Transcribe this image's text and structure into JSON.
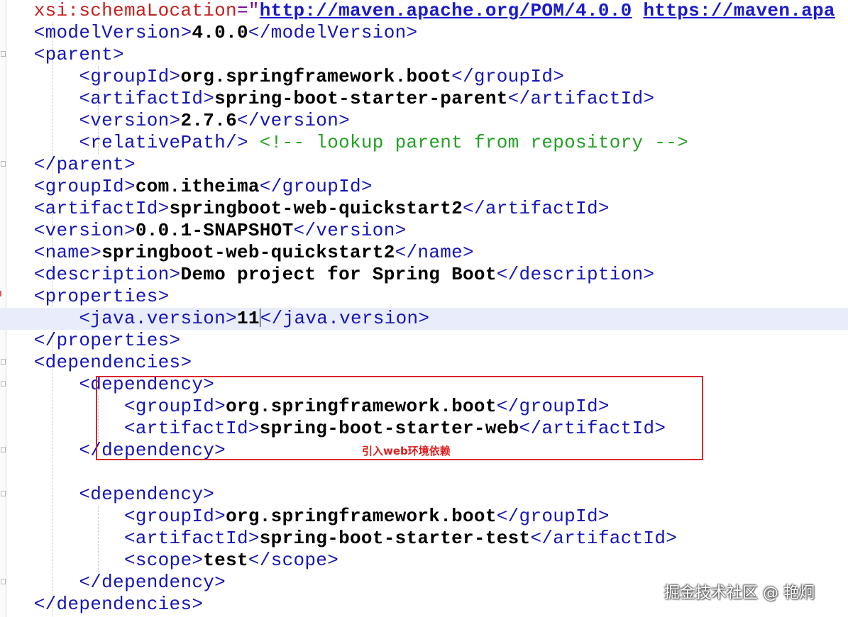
{
  "xml": {
    "l1": {
      "attr": "xsi:schemaLocation",
      "eq": "=\"",
      "url1": "http://maven.apache.org/POM/4.0.0",
      "sp": " ",
      "url2": "https://maven.apa"
    },
    "l2": {
      "open": "<modelVersion>",
      "value": "4.0.0",
      "close": "</modelVersion>"
    },
    "l3": {
      "tag": "<parent>"
    },
    "l4": {
      "open": "<groupId>",
      "value": "org.springframework.boot",
      "close": "</groupId>"
    },
    "l5": {
      "open": "<artifactId>",
      "value": "spring-boot-starter-parent",
      "close": "</artifactId>"
    },
    "l6": {
      "open": "<version>",
      "value": "2.7.6",
      "close": "</version>"
    },
    "l7": {
      "tag": "<relativePath/>",
      "comment": " <!-- lookup parent from repository -->"
    },
    "l8": {
      "tag": "</parent>"
    },
    "l9": {
      "open": "<groupId>",
      "value": "com.itheima",
      "close": "</groupId>"
    },
    "l10": {
      "open": "<artifactId>",
      "value": "springboot-web-quickstart2",
      "close": "</artifactId>"
    },
    "l11": {
      "open": "<version>",
      "value": "0.0.1-SNAPSHOT",
      "close": "</version>"
    },
    "l12": {
      "open": "<name>",
      "value": "springboot-web-quickstart2",
      "close": "</name>"
    },
    "l13": {
      "open": "<description>",
      "value": "Demo project for Spring Boot",
      "close": "</description>"
    },
    "l14": {
      "tag": "<properties>"
    },
    "l15": {
      "open": "<java.version>",
      "value": "11",
      "close": "</java.version>"
    },
    "l16": {
      "tag": "</properties>"
    },
    "l17": {
      "tag": "<dependencies>"
    },
    "l18": {
      "tag": "<dependency>"
    },
    "l19": {
      "open": "<groupId>",
      "value": "org.springframework.boot",
      "close": "</groupId>"
    },
    "l20": {
      "open": "<artifactId>",
      "value": "spring-boot-starter-web",
      "close": "</artifactId>"
    },
    "l21": {
      "tag": "</dependency>"
    },
    "l23": {
      "tag": "<dependency>"
    },
    "l24": {
      "open": "<groupId>",
      "value": "org.springframework.boot",
      "close": "</groupId>"
    },
    "l25": {
      "open": "<artifactId>",
      "value": "spring-boot-starter-test",
      "close": "</artifactId>"
    },
    "l26": {
      "open": "<scope>",
      "value": "test",
      "close": "</scope>"
    },
    "l27": {
      "tag": "</dependency>"
    },
    "l28": {
      "tag": "</dependencies>"
    }
  },
  "annotation": "引入web环境依赖",
  "watermark": "掘金技术社区 @ 艳炯",
  "colors": {
    "tag": "#1515b8",
    "attribute": "#c81e1e",
    "url": "#1a1acc",
    "comment": "#22a022",
    "highlight_box": "#d9262c",
    "current_line": "#e8ecfb"
  }
}
